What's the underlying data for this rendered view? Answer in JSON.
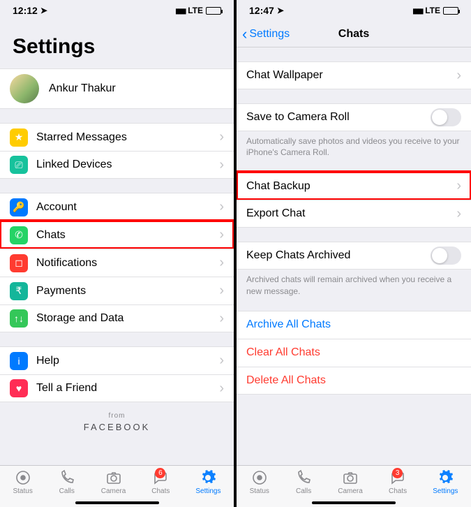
{
  "left": {
    "status": {
      "time": "12:12",
      "network": "LTE"
    },
    "title": "Settings",
    "profile": {
      "name": "Ankur Thakur"
    },
    "group1": [
      {
        "icon": "★",
        "bg": "#ffcc00",
        "label": "Starred Messages"
      },
      {
        "icon": "⎚",
        "bg": "#16c29c",
        "label": "Linked Devices"
      }
    ],
    "group2": [
      {
        "icon": "🔑",
        "bg": "#007aff",
        "label": "Account"
      },
      {
        "icon": "✆",
        "bg": "#25d366",
        "label": "Chats",
        "highlight": true
      },
      {
        "icon": "◻",
        "bg": "#ff3b30",
        "label": "Notifications"
      },
      {
        "icon": "₹",
        "bg": "#14b69a",
        "label": "Payments"
      },
      {
        "icon": "↑↓",
        "bg": "#34c759",
        "label": "Storage and Data"
      }
    ],
    "group3": [
      {
        "icon": "i",
        "bg": "#007aff",
        "label": "Help"
      },
      {
        "icon": "♥",
        "bg": "#ff2d55",
        "label": "Tell a Friend"
      }
    ],
    "footer": {
      "from": "from",
      "brand": "FACEBOOK"
    },
    "tabs": {
      "status": "Status",
      "calls": "Calls",
      "camera": "Camera",
      "chats": "Chats",
      "settings": "Settings",
      "badge": "6"
    }
  },
  "right": {
    "status": {
      "time": "12:47",
      "network": "LTE"
    },
    "nav": {
      "back": "Settings",
      "title": "Chats"
    },
    "row_wallpaper": "Chat Wallpaper",
    "row_camera_roll": "Save to Camera Roll",
    "hint_camera": "Automatically save photos and videos you receive to your iPhone's Camera Roll.",
    "row_backup": "Chat Backup",
    "row_export": "Export Chat",
    "row_keep_archived": "Keep Chats Archived",
    "hint_archived": "Archived chats will remain archived when you receive a new message.",
    "row_archive_all": "Archive All Chats",
    "row_clear_all": "Clear All Chats",
    "row_delete_all": "Delete All Chats",
    "tabs": {
      "status": "Status",
      "calls": "Calls",
      "camera": "Camera",
      "chats": "Chats",
      "settings": "Settings",
      "badge": "3"
    }
  }
}
